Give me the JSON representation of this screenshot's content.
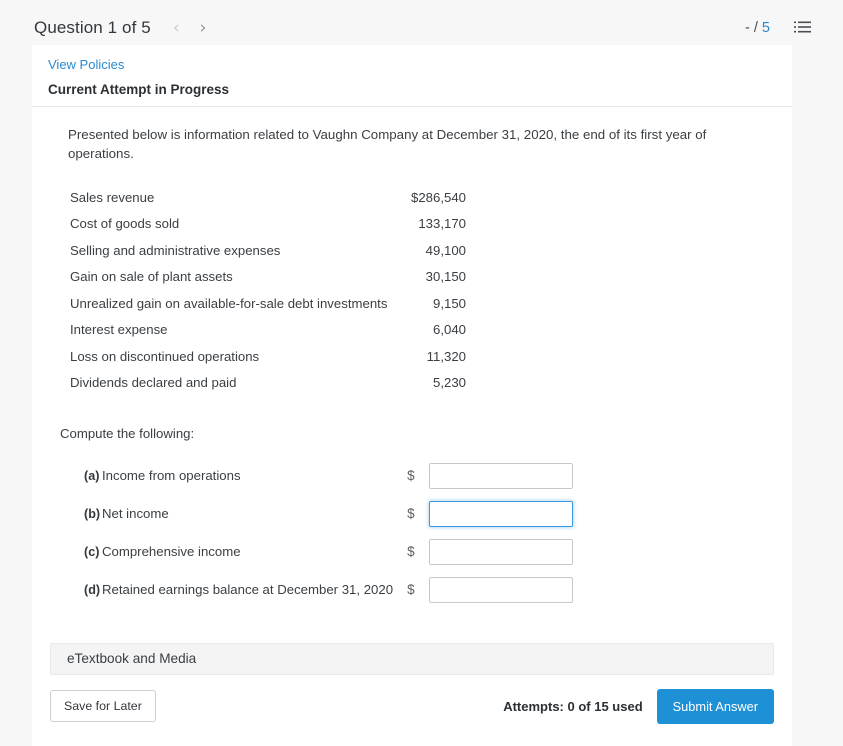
{
  "header": {
    "question_title": "Question 1 of 5",
    "prev_icon": "chevron-left-icon",
    "next_icon": "chevron-right-icon",
    "score_earned": "-",
    "score_separator": "/",
    "score_total": "5",
    "score_text": "- / 5",
    "list_icon": "numbered-list-icon"
  },
  "card": {
    "view_policies_label": "View Policies",
    "attempt_status": "Current Attempt in Progress",
    "intro": "Presented below is information related to Vaughn Company at December 31, 2020, the end of its first year of operations.",
    "compute_label": "Compute the following:"
  },
  "figures": [
    {
      "label": "Sales revenue",
      "amount": "$286,540"
    },
    {
      "label": "Cost of goods sold",
      "amount": "133,170"
    },
    {
      "label": "Selling and administrative expenses",
      "amount": "49,100"
    },
    {
      "label": "Gain on sale of plant assets",
      "amount": "30,150"
    },
    {
      "label": "Unrealized gain on available-for-sale debt investments",
      "amount": "9,150"
    },
    {
      "label": "Interest expense",
      "amount": "6,040"
    },
    {
      "label": "Loss on discontinued operations",
      "amount": "11,320"
    },
    {
      "label": "Dividends declared and paid",
      "amount": "5,230"
    }
  ],
  "answers": [
    {
      "letter": "(a)",
      "text": "Income from operations",
      "currency": "$",
      "value": "",
      "focused": false
    },
    {
      "letter": "(b)",
      "text": "Net income",
      "currency": "$",
      "value": "",
      "focused": true
    },
    {
      "letter": "(c)",
      "text": "Comprehensive income",
      "currency": "$",
      "value": "",
      "focused": false
    },
    {
      "letter": "(d)",
      "text": "Retained earnings balance at December 31, 2020",
      "currency": "$",
      "value": "",
      "focused": false
    }
  ],
  "footer": {
    "etextbook_label": "eTextbook and Media",
    "save_label": "Save for Later",
    "attempts_text": "Attempts: 0 of 15 used",
    "submit_label": "Submit Answer"
  },
  "colors": {
    "link_blue": "#2b8ad0",
    "accent_blue": "#1e91d6",
    "focus_border": "#3d9ae0",
    "page_bg": "#f7f7f7",
    "card_bg": "#ffffff",
    "text": "#3a3f44"
  }
}
